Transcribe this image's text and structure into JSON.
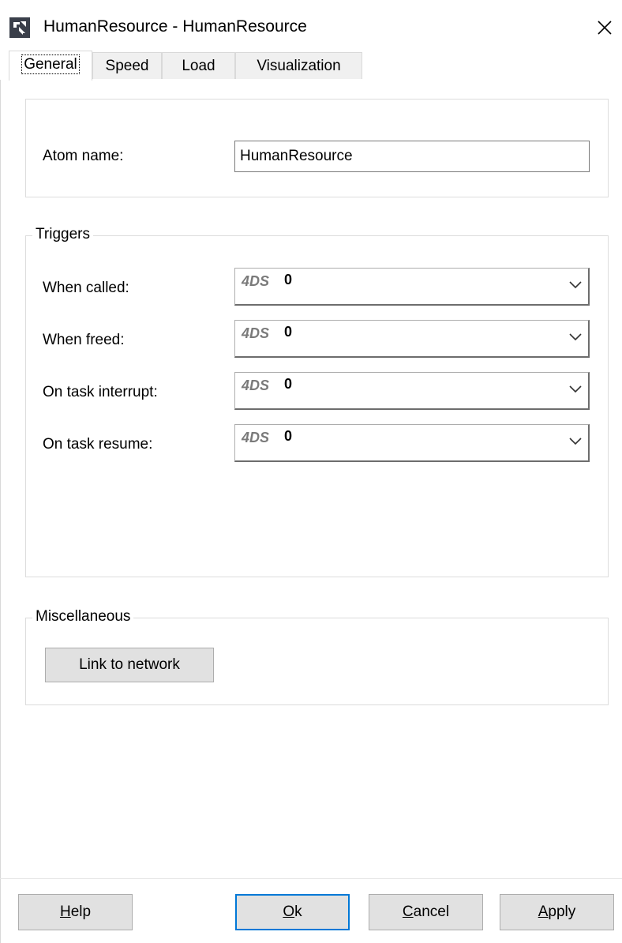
{
  "window": {
    "title": "HumanResource - HumanResource"
  },
  "tabs": [
    {
      "label": "General",
      "active": true
    },
    {
      "label": "Speed",
      "active": false
    },
    {
      "label": "Load",
      "active": false
    },
    {
      "label": "Visualization",
      "active": false
    }
  ],
  "general": {
    "atom_name_label": "Atom name:",
    "atom_name_value": "HumanResource"
  },
  "triggers": {
    "legend": "Triggers",
    "items": [
      {
        "label": "When called:",
        "prefix": "4DS",
        "value": "0"
      },
      {
        "label": "When freed:",
        "prefix": "4DS",
        "value": "0"
      },
      {
        "label": "On task interrupt:",
        "prefix": "4DS",
        "value": "0"
      },
      {
        "label": "On task resume:",
        "prefix": "4DS",
        "value": "0"
      }
    ]
  },
  "misc": {
    "legend": "Miscellaneous",
    "link_button": "Link to network"
  },
  "footer": {
    "help": {
      "mnemonic": "H",
      "rest": "elp"
    },
    "ok": {
      "mnemonic": "O",
      "rest": "k"
    },
    "cancel": {
      "mnemonic": "C",
      "rest": "ancel"
    },
    "apply": {
      "mnemonic": "A",
      "rest": "pply"
    }
  },
  "colors": {
    "default_button_border": "#0078d7",
    "button_face": "#e1e1e1",
    "group_border": "#dcdcdc"
  },
  "icons": [
    "app-icon",
    "close-icon",
    "chevron-down-icon"
  ]
}
